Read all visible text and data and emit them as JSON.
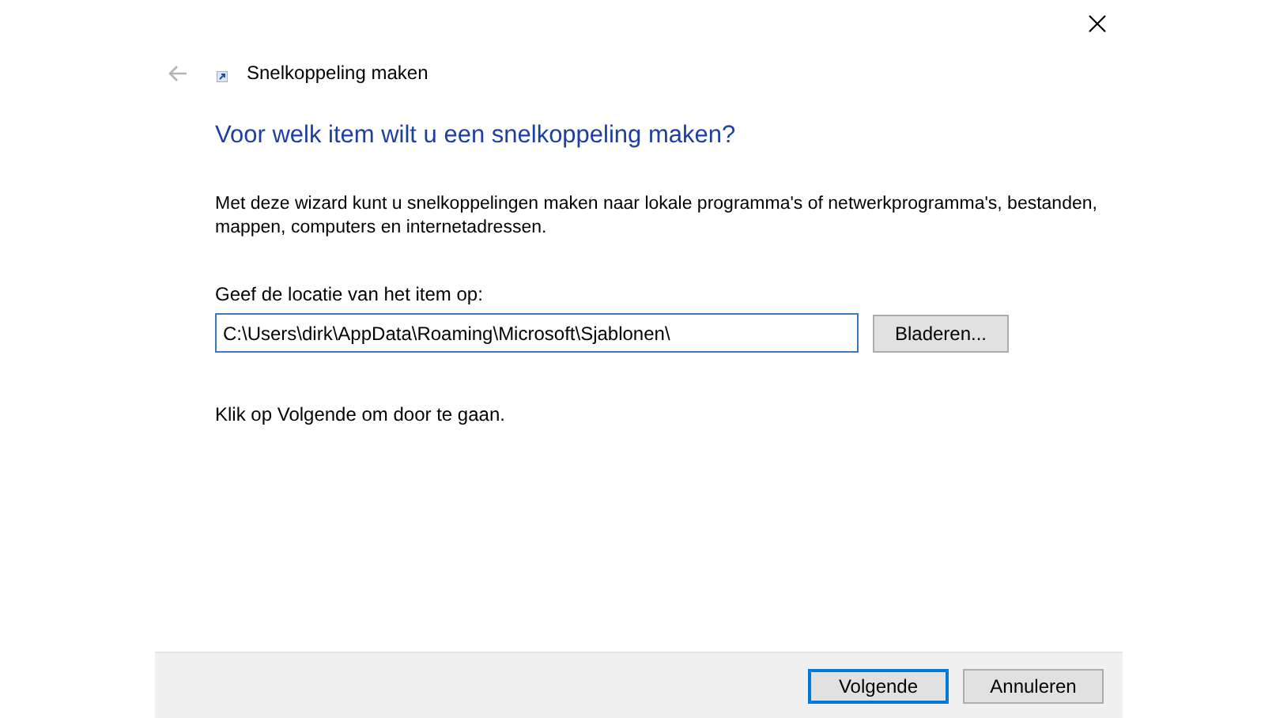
{
  "window": {
    "title": "Snelkoppeling maken",
    "back_disabled": true
  },
  "heading": "Voor welk item wilt u een snelkoppeling maken?",
  "description": "Met deze wizard kunt u snelkoppelingen maken naar lokale programma's of netwerkprogramma's, bestanden, mappen, computers en internetadressen.",
  "location_label": "Geef de locatie van het item op:",
  "location_field": {
    "value": "C:\\Users\\dirk\\AppData\\Roaming\\Microsoft\\Sjablonen\\"
  },
  "browse_button": "Bladeren...",
  "hint": "Klik op Volgende om door te gaan.",
  "buttons": [
    {
      "label": "Volgende",
      "selected": true
    },
    {
      "label": "Annuleren",
      "selected": false
    }
  ]
}
